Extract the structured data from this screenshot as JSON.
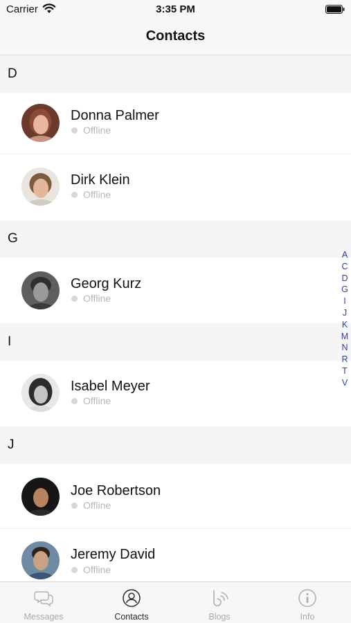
{
  "status_bar": {
    "carrier": "Carrier",
    "time": "3:35 PM",
    "icons": [
      "wifi-icon",
      "battery-icon"
    ]
  },
  "nav": {
    "title": "Contacts"
  },
  "sections": [
    {
      "letter": "D",
      "contacts": [
        {
          "name": "Donna Palmer",
          "status": "Offline",
          "avatar": "avatar-photo"
        },
        {
          "name": "Dirk Klein",
          "status": "Offline",
          "avatar": "avatar-photo"
        }
      ]
    },
    {
      "letter": "G",
      "contacts": [
        {
          "name": "Georg Kurz",
          "status": "Offline",
          "avatar": "avatar-photo"
        }
      ]
    },
    {
      "letter": "I",
      "contacts": [
        {
          "name": "Isabel Meyer",
          "status": "Offline",
          "avatar": "avatar-photo"
        }
      ]
    },
    {
      "letter": "J",
      "contacts": [
        {
          "name": "Joe Robertson",
          "status": "Offline",
          "avatar": "avatar-photo"
        },
        {
          "name": "Jeremy David",
          "status": "Offline",
          "avatar": "avatar-photo"
        }
      ]
    }
  ],
  "index_letters": [
    "A",
    "C",
    "D",
    "G",
    "I",
    "J",
    "K",
    "M",
    "N",
    "R",
    "T",
    "V"
  ],
  "tabs": [
    {
      "label": "Messages",
      "icon": "chat-bubbles-icon",
      "active": false
    },
    {
      "label": "Contacts",
      "icon": "contacts-icon",
      "active": true
    },
    {
      "label": "Blogs",
      "icon": "blog-icon",
      "active": false
    },
    {
      "label": "Info",
      "icon": "info-icon",
      "active": false
    }
  ],
  "colors": {
    "accent_index": "#2b3fa8",
    "status_offline": "#d7d7d7",
    "section_bg": "#f5f5f5",
    "bar_bg": "#f7f7f7"
  }
}
